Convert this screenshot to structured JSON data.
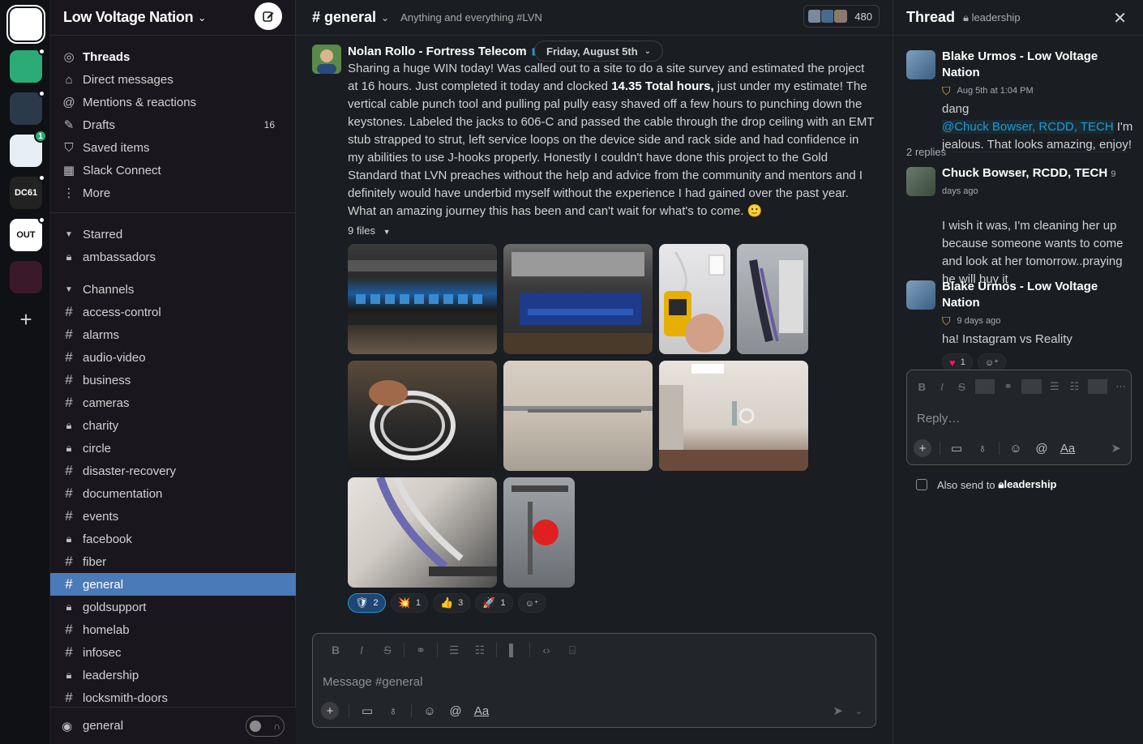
{
  "rail": {
    "workspaces": [
      {
        "name": "low-voltage-nation",
        "abbr": "",
        "bg": "#ffffff",
        "fg": "#111111",
        "active": true
      },
      {
        "name": "workspace-green",
        "abbr": "",
        "bg": "#2bac76",
        "dot": true
      },
      {
        "name": "workspace-space",
        "abbr": "",
        "bg": "#2a3a4a",
        "dot": true
      },
      {
        "name": "workspace-circle",
        "abbr": "",
        "bg": "#e8eef5",
        "badge": "1"
      },
      {
        "name": "workspace-dc61",
        "abbr": "DC61",
        "bg": "#222222",
        "dot": true
      },
      {
        "name": "workspace-out-in-tech",
        "abbr": "OUT",
        "bg": "#ffffff",
        "fg": "#111111",
        "dot": true
      },
      {
        "name": "workspace-dark",
        "abbr": "",
        "bg": "#3a1a2a"
      }
    ]
  },
  "sidebar": {
    "workspace_name": "Low Voltage Nation",
    "nav": [
      {
        "label": "Threads",
        "icon": "threads-icon",
        "glyph": "◎",
        "bold": true
      },
      {
        "label": "Direct messages",
        "icon": "dm-icon",
        "glyph": "⌂"
      },
      {
        "label": "Mentions & reactions",
        "icon": "at-icon",
        "glyph": "@"
      },
      {
        "label": "Drafts",
        "icon": "pencil-icon",
        "glyph": "✎",
        "count": "16"
      },
      {
        "label": "Saved items",
        "icon": "bookmark-icon",
        "glyph": "⛉"
      },
      {
        "label": "Slack Connect",
        "icon": "building-icon",
        "glyph": "▦"
      },
      {
        "label": "More",
        "icon": "more-icon",
        "glyph": "⋮"
      }
    ],
    "starred_label": "Starred",
    "starred": [
      {
        "label": "ambassadors",
        "private": true
      }
    ],
    "channels_label": "Channels",
    "channels": [
      {
        "label": "access-control",
        "private": false
      },
      {
        "label": "alarms",
        "private": false
      },
      {
        "label": "audio-video",
        "private": false
      },
      {
        "label": "business",
        "private": false
      },
      {
        "label": "cameras",
        "private": false
      },
      {
        "label": "charity",
        "private": true
      },
      {
        "label": "circle",
        "private": true
      },
      {
        "label": "disaster-recovery",
        "private": false
      },
      {
        "label": "documentation",
        "private": false
      },
      {
        "label": "events",
        "private": false
      },
      {
        "label": "facebook",
        "private": true
      },
      {
        "label": "fiber",
        "private": false
      },
      {
        "label": "general",
        "private": false,
        "selected": true
      },
      {
        "label": "goldsupport",
        "private": true
      },
      {
        "label": "homelab",
        "private": false
      },
      {
        "label": "infosec",
        "private": false
      },
      {
        "label": "leadership",
        "private": true
      },
      {
        "label": "locksmith-doors",
        "private": false
      }
    ],
    "huddle_label": "general"
  },
  "channel": {
    "name": "# general",
    "topic": "Anything and everything #LVN",
    "member_count": "480"
  },
  "message": {
    "author": "Nolan Rollo - Fortress Telecom",
    "date_pill": "Friday, August 5th",
    "text_before": "Sharing a huge WIN today! Was called out to a site to do a site survey and estimated the project at 16 hours. Just completed it today and clocked ",
    "text_bold": "14.35 Total hours,",
    "text_after": " just under my estimate! The vertical cable punch tool and pulling pal pully easy shaved off a few hours to punching down the keystones. Labeled the jacks to 606-C and passed the cable through the drop ceiling with an EMT stub strapped to strut, left service loops on the device side and rack side and had confidence in my abilities to use J-hooks properly. Honestly I couldn't have done this project to the Gold Standard that LVN preaches without the help and advice from the community and mentors and I definitely would have underbid myself without the experience I had gained over the past year. What an amazing journey this has been and can't wait for what's to come. 🙂",
    "files_label": "9 files",
    "reactions": [
      {
        "emoji": "🛡",
        "count": "2",
        "mine": true
      },
      {
        "emoji": "💥",
        "count": "1"
      },
      {
        "emoji": "👍",
        "count": "3"
      },
      {
        "emoji": "🚀",
        "count": "1"
      }
    ]
  },
  "composer": {
    "placeholder": "Message #general"
  },
  "thread": {
    "title": "Thread",
    "channel": "leadership",
    "messages": [
      {
        "author": "Blake Urmos - Low Voltage Nation",
        "meta": "Aug 5th at 1:04 PM",
        "text": "dang",
        "mention": "@Chuck Bowser, RCDD, TECH",
        "text_after": " I'm jealous. That looks amazing, enjoy!"
      },
      {
        "author": "Chuck Bowser, RCDD, TECH",
        "meta": "9 days ago",
        "text": "I wish it was, I'm cleaning her up because someone wants to come and look at her tomorrow..praying he will buy it"
      },
      {
        "author": "Blake Urmos - Low Voltage Nation",
        "meta": "9 days ago",
        "text": "ha! Instagram vs Reality",
        "reactions": [
          {
            "emoji": "❤️",
            "count": "1"
          }
        ]
      }
    ],
    "replies_label": "2 replies",
    "reply_placeholder": "Reply…",
    "also_send_label": "Also send to",
    "also_send_channel": "leadership"
  }
}
